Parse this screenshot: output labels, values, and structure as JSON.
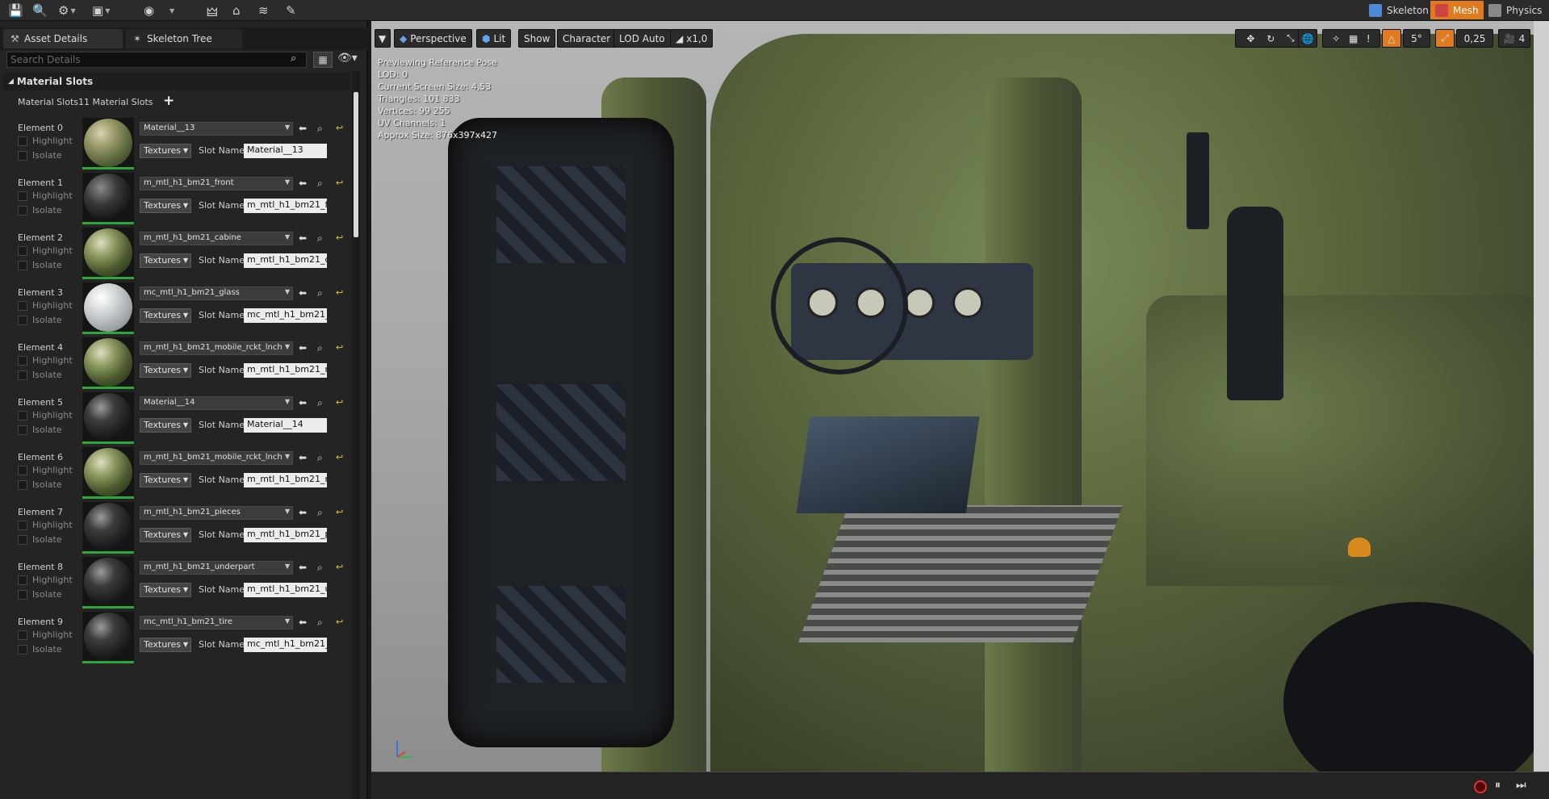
{
  "topbar": {
    "modes": [
      {
        "label": "Skeleton",
        "icon": "skeleton-icon",
        "active": false
      },
      {
        "label": "Mesh",
        "icon": "mesh-icon",
        "active": true
      },
      {
        "label": "Physics",
        "icon": "physics-icon",
        "active": false
      }
    ],
    "accent_color": "#e07a1f"
  },
  "tabs": [
    {
      "label": "Asset Details",
      "icon": "asset-details-icon",
      "active": true
    },
    {
      "label": "Skeleton Tree",
      "icon": "skeleton-tree-icon",
      "active": false
    }
  ],
  "search": {
    "placeholder": "Search Details"
  },
  "section": {
    "title": "Material Slots"
  },
  "slots": {
    "label": "Material Slots",
    "count_text": "11 Material Slots"
  },
  "elements": [
    {
      "name": "Element 0",
      "material": "Material__13",
      "slot_name": "Material__13",
      "ball": "rock"
    },
    {
      "name": "Element 1",
      "material": "m_mtl_h1_bm21_front",
      "slot_name": "m_mtl_h1_bm21_fr",
      "ball": "dark-orange"
    },
    {
      "name": "Element 2",
      "material": "m_mtl_h1_bm21_cabine",
      "slot_name": "m_mtl_h1_bm21_c",
      "ball": "camo"
    },
    {
      "name": "Element 3",
      "material": "mc_mtl_h1_bm21_glass",
      "slot_name": "mc_mtl_h1_bm21_",
      "ball": "glass"
    },
    {
      "name": "Element 4",
      "material": "m_mtl_h1_bm21_mobile_rckt_lnch",
      "slot_name": "m_mtl_h1_bm21_n",
      "ball": "camo"
    },
    {
      "name": "Element 5",
      "material": "Material__14",
      "slot_name": "Material__14",
      "ball": "dark"
    },
    {
      "name": "Element 6",
      "material": "m_mtl_h1_bm21_mobile_rckt_lnch",
      "slot_name": "m_mtl_h1_bm21_n",
      "ball": "camo"
    },
    {
      "name": "Element 7",
      "material": "m_mtl_h1_bm21_pieces",
      "slot_name": "m_mtl_h1_bm21_p",
      "ball": "dark"
    },
    {
      "name": "Element 8",
      "material": "m_mtl_h1_bm21_underpart",
      "slot_name": "m_mtl_h1_bm21_u",
      "ball": "dark"
    },
    {
      "name": "Element 9",
      "material": "mc_mtl_h1_bm21_tire",
      "slot_name": "mc_mtl_h1_bm21_",
      "ball": "dark"
    }
  ],
  "element_labels": {
    "highlight": "Highlight",
    "isolate": "Isolate",
    "textures": "Textures",
    "slot_name": "Slot Name"
  },
  "viewport": {
    "toolbar": {
      "perspective": "Perspective",
      "lit": "Lit",
      "show": "Show",
      "character": "Character",
      "lod": "LOD Auto",
      "speed": "x1,0",
      "angle_snap": "5°",
      "scale_snap": "0,25",
      "camera_speed": "4"
    },
    "info": [
      "Previewing Reference Pose",
      "LOD: 0",
      "Current Screen Size: 4,53",
      "Triangles: 101 833",
      "Vertices: 99 255",
      "UV Channels: 1",
      "Approx Size: 876x397x427"
    ]
  }
}
